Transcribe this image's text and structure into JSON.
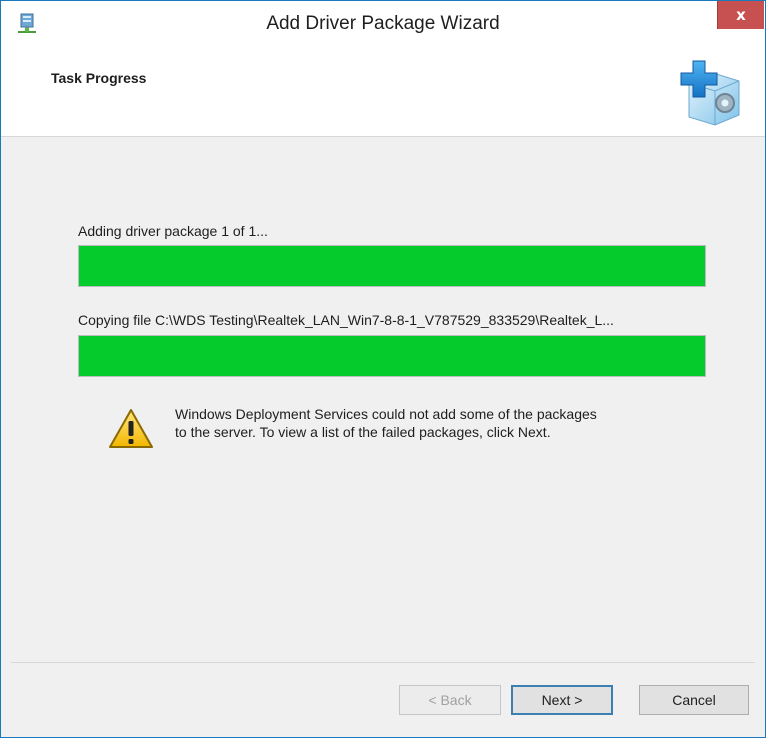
{
  "window": {
    "title": "Add Driver Package Wizard",
    "close_glyph": "x",
    "icon": "wds-server-icon"
  },
  "header": {
    "title": "Task Progress",
    "art_icon": "driver-package-plus-icon"
  },
  "progress": {
    "package_status": "Adding driver package 1 of 1...",
    "package_percent": 100,
    "file_status": "Copying file C:\\WDS Testing\\Realtek_LAN_Win7-8-8-1_V787529_833529\\Realtek_L...",
    "file_percent": 100,
    "fill_color": "#06cb2d"
  },
  "warning": {
    "icon": "warning-icon",
    "line1": "Windows Deployment Services could not add some of the packages",
    "line2": "to the server. To view a list of the failed packages, click Next."
  },
  "buttons": {
    "back": "< Back",
    "next": "Next >",
    "cancel": "Cancel"
  }
}
